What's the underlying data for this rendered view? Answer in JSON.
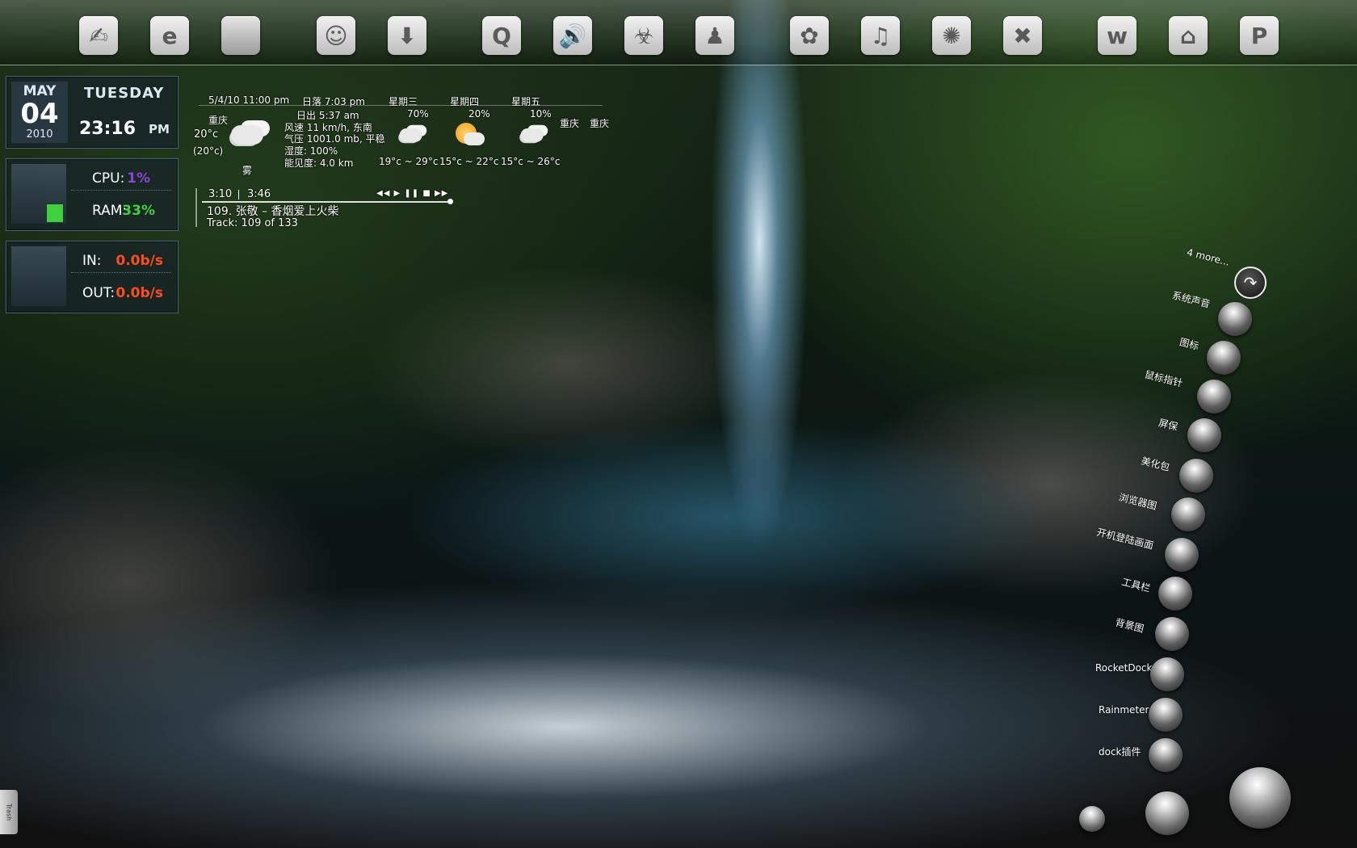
{
  "dock": {
    "icons": [
      {
        "name": "finder-icon",
        "glyph": "✍"
      },
      {
        "name": "internet-explorer-icon",
        "glyph": "e"
      },
      {
        "name": "apple-icon",
        "glyph": ""
      },
      {
        "name": "qq-icon",
        "glyph": "☺"
      },
      {
        "name": "download-icon",
        "glyph": "⬇"
      },
      {
        "name": "quicktime-icon",
        "glyph": "Q"
      },
      {
        "name": "volume-icon",
        "glyph": "🔊"
      },
      {
        "name": "biohazard-icon",
        "glyph": "☣"
      },
      {
        "name": "user-chair-icon",
        "glyph": "♟"
      },
      {
        "name": "flower-icon",
        "glyph": "✿"
      },
      {
        "name": "music-note-icon",
        "glyph": "♫"
      },
      {
        "name": "settings-gear-icon",
        "glyph": "✺"
      },
      {
        "name": "x-app-icon",
        "glyph": "✖"
      },
      {
        "name": "w-app-icon",
        "glyph": "w"
      },
      {
        "name": "home-icon",
        "glyph": "⌂"
      },
      {
        "name": "p-app-icon",
        "glyph": "P"
      }
    ]
  },
  "clock": {
    "month": "MAY",
    "day": "04",
    "year": "2010",
    "weekday": "TUESDAY",
    "time": "23:16",
    "ampm": "PM"
  },
  "system": {
    "cpu_label": "CPU:",
    "cpu_value": "1%",
    "ram_label": "RAM:",
    "ram_value": "33%",
    "cpu_color": "#8e44d6",
    "ram_color": "#3fcf3f"
  },
  "network": {
    "in_label": "IN:",
    "in_value": "0.0b/s",
    "out_label": "OUT:",
    "out_value": "0.0b/s",
    "color": "#ff4d1a"
  },
  "weather": {
    "updated": "5/4/10 11:00 pm",
    "sunset": "日落 7:03 pm",
    "sunrise": "日出 5:37 am",
    "wind": "风速 11 km/h, 东南",
    "pressure": "气压 1001.0 mb, 平稳",
    "humidity": "湿度: 100%",
    "visibility": "能见度: 4.0 km",
    "city": "重庆",
    "temp": "20°c",
    "feels": "(20°c)",
    "condition": "雾",
    "forecast": [
      {
        "day": "星期三",
        "chance": "70%",
        "range": "19°c ~ 29°c"
      },
      {
        "day": "星期四",
        "chance": "20%",
        "range": "15°c ~ 22°c"
      },
      {
        "day": "星期五",
        "chance": "10%",
        "range": "15°c ~ 26°c"
      }
    ],
    "extra_city_1": "重庆",
    "extra_city_2": "重庆"
  },
  "media": {
    "elapsed": "3:10",
    "total": "3:46",
    "title": "109. 张敬 – 香烟爱上火柴",
    "track": "Track: 109 of 133",
    "controls": "◀◀ ▶ ❚❚ ■ ▶▶"
  },
  "rightmenu": {
    "items": [
      "4 more...",
      "系统声音",
      "图标",
      "鼠标指针",
      "屏保",
      "美化包",
      "浏览器图",
      "开机登陆画面",
      "工具栏",
      "背景图",
      "RocketDock",
      "Rainmeter",
      "dock插件"
    ]
  },
  "trash_label": "Trash"
}
